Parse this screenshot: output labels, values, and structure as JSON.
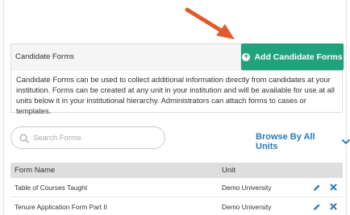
{
  "panel": {
    "title": "Candidate Forms",
    "description": "Candidate Forms can be used to collect additional information directly from candidates at your institution. Forms can be created at any unit in your institution and will be available for use at all units below it in your institutional hierarchy. Administrators can attach forms to cases or templates.",
    "add_button_label": "Add Candidate Forms"
  },
  "search": {
    "placeholder": "Search Forms"
  },
  "browse": {
    "label": "Browse By All Units"
  },
  "table": {
    "columns": [
      "Form Name",
      "Unit"
    ],
    "rows": [
      {
        "name": "Table of Courses Taught",
        "unit": "Demo University"
      },
      {
        "name": "Tenure Application Form Part II",
        "unit": "Demo University"
      }
    ]
  },
  "colors": {
    "accent_green": "#22a27c",
    "link_blue": "#2b7ab8",
    "arrow": "#e05a2b"
  },
  "icons": [
    "arrow-annotation",
    "plus-circle-icon",
    "search-icon",
    "chevron-down-icon",
    "pencil-icon",
    "close-icon"
  ]
}
